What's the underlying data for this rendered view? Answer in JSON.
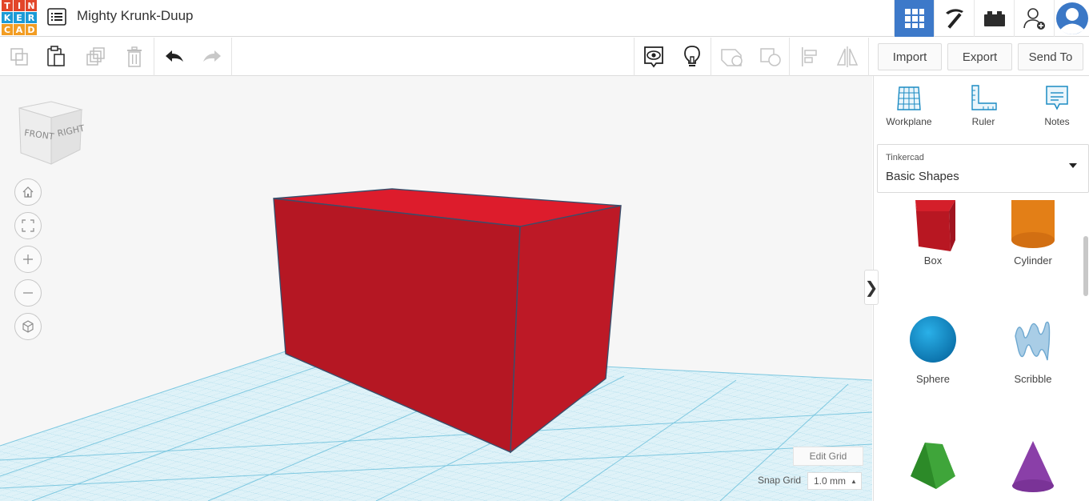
{
  "app": {
    "logo_letters": [
      "T",
      "I",
      "N",
      "K",
      "E",
      "R",
      "C",
      "A",
      "D"
    ],
    "logo_colors": [
      "#e2462a",
      "#e2462a",
      "#e2462a",
      "#1c9ad6",
      "#1c9ad6",
      "#1c9ad6",
      "#f29d23",
      "#f29d23",
      "#f29d23"
    ],
    "design_title": "Mighty Krunk-Duup"
  },
  "topnav": {
    "items": [
      {
        "name": "3d-view-grid-icon",
        "active": true
      },
      {
        "name": "pickaxe-icon",
        "active": false
      },
      {
        "name": "bricks-icon",
        "active": false
      },
      {
        "name": "add-user-icon",
        "active": false
      },
      {
        "name": "user-avatar",
        "active": false
      }
    ]
  },
  "toolbar": {
    "icons": [
      "copy-icon",
      "paste-icon",
      "duplicate-icon",
      "trash-icon",
      "undo-icon",
      "redo-icon",
      "notes-visibility-icon",
      "lightbulb-icon",
      "group-icon",
      "ungroup-icon",
      "align-icon",
      "mirror-icon"
    ],
    "import_label": "Import",
    "export_label": "Export",
    "sendto_label": "Send To"
  },
  "viewcube": {
    "front": "FRONT",
    "right": "RIGHT"
  },
  "canvas": {
    "edit_grid_label": "Edit Grid",
    "snap_grid_label": "Snap Grid",
    "snap_grid_value": "1.0 mm",
    "shape_color": "#b51723",
    "shape_top_color": "#d51a2a",
    "grid_color": "#7ec8e0"
  },
  "panel": {
    "tools": [
      {
        "label": "Workplane",
        "icon": "workplane-icon"
      },
      {
        "label": "Ruler",
        "icon": "ruler-icon"
      },
      {
        "label": "Notes",
        "icon": "notes-icon"
      }
    ],
    "library_source": "Tinkercad",
    "library_name": "Basic Shapes",
    "shapes": [
      {
        "label": "Box",
        "icon": "box-shape-icon"
      },
      {
        "label": "Cylinder",
        "icon": "cylinder-shape-icon"
      },
      {
        "label": "Sphere",
        "icon": "sphere-shape-icon"
      },
      {
        "label": "Scribble",
        "icon": "scribble-shape-icon"
      },
      {
        "label": "",
        "icon": "roof-shape-icon"
      },
      {
        "label": "",
        "icon": "cone-shape-icon"
      }
    ]
  }
}
